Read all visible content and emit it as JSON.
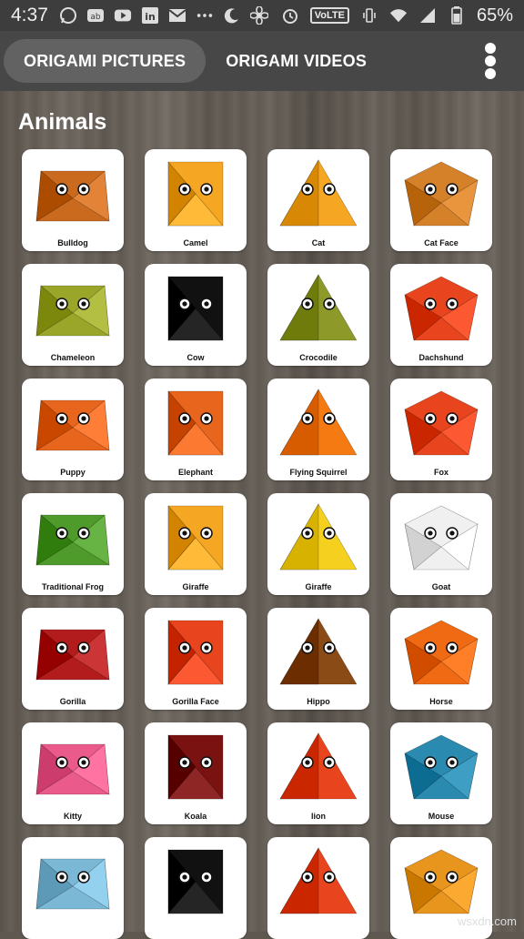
{
  "status_bar": {
    "time": "4:37",
    "battery": "65%",
    "network_badge": "VoLTE",
    "icons": [
      "whatsapp-icon",
      "ab-icon",
      "youtube-icon",
      "linkedin-icon",
      "gmail-icon",
      "dots-icon",
      "moon-icon",
      "fan-icon",
      "alarm-icon",
      "vibrate-icon",
      "wifi-icon",
      "signal-icon",
      "battery-icon"
    ]
  },
  "tabs": [
    {
      "label": "ORIGAMI PICTURES",
      "active": true
    },
    {
      "label": "ORIGAMI VIDEOS",
      "active": false
    }
  ],
  "section": {
    "title": "Animals"
  },
  "items": [
    {
      "label": "Bulldog",
      "color": "#c96a1e"
    },
    {
      "label": "Camel",
      "color": "#f5a623"
    },
    {
      "label": "Cat",
      "color": "#f5a623"
    },
    {
      "label": "Cat Face",
      "color": "#d5812a"
    },
    {
      "label": "Chameleon",
      "color": "#9aa62a"
    },
    {
      "label": "Cow",
      "color": "#111111"
    },
    {
      "label": "Crocodile",
      "color": "#8d9a2a"
    },
    {
      "label": "Dachshund",
      "color": "#e8451e"
    },
    {
      "label": "Puppy",
      "color": "#e8651e"
    },
    {
      "label": "Elephant",
      "color": "#e8651e"
    },
    {
      "label": "Flying Squirrel",
      "color": "#f57a12"
    },
    {
      "label": "Fox",
      "color": "#e8451e"
    },
    {
      "label": "Traditional Frog",
      "color": "#4e9a2a"
    },
    {
      "label": "Giraffe",
      "color": "#f5a623"
    },
    {
      "label": "Giraffe",
      "color": "#f5d01e"
    },
    {
      "label": "Goat",
      "color": "#f0f0f0"
    },
    {
      "label": "Gorilla",
      "color": "#b31c1c"
    },
    {
      "label": "Gorilla Face",
      "color": "#e8451e"
    },
    {
      "label": "Hippo",
      "color": "#8a4b16"
    },
    {
      "label": "Horse",
      "color": "#f06a14"
    },
    {
      "label": "Kitty",
      "color": "#ea5a8a"
    },
    {
      "label": "Koala",
      "color": "#7a1212"
    },
    {
      "label": "lion",
      "color": "#e8451e"
    },
    {
      "label": "Mouse",
      "color": "#2a8ab0"
    },
    {
      "label": "",
      "color": "#7ab8d6"
    },
    {
      "label": "",
      "color": "#111111"
    },
    {
      "label": "",
      "color": "#e8451e"
    },
    {
      "label": "",
      "color": "#e8951e"
    }
  ],
  "watermark": "wsxdn.com"
}
